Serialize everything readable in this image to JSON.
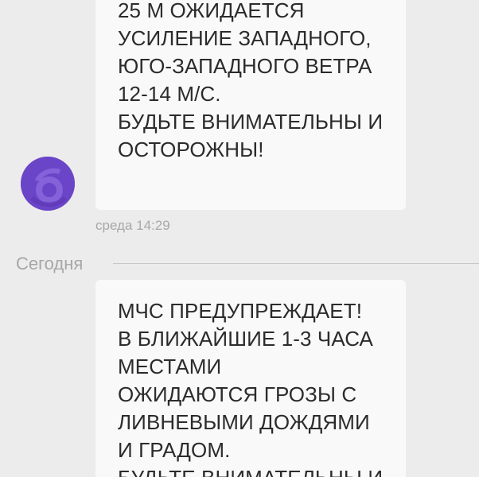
{
  "messages": [
    {
      "lines": [
        "25 М ОЖИДАЕТСЯ",
        "УСИЛЕНИЕ ЗАПАДНОГО,",
        "ЮГО-ЗАПАДНОГО ВЕТРА",
        "12-14 М/С.",
        "БУДЬТЕ ВНИМАТЕЛЬНЫ И",
        "ОСТОРОЖНЫ!"
      ],
      "timestamp": "среда 14:29"
    },
    {
      "lines": [
        "МЧС ПРЕДУПРЕЖДАЕТ!",
        "В БЛИЖАЙШИЕ 1-3 ЧАСА",
        "МЕСТАМИ",
        "ОЖИДАЮТСЯ ГРОЗЫ С",
        "ЛИВНЕВЫМИ ДОЖДЯМИ",
        "И ГРАДОМ.",
        "БУДЬТЕ ВНИМАТЕЛЬНЫ И"
      ]
    }
  ],
  "date_divider": "Сегодня",
  "avatar": {
    "icon": "sender-avatar-icon",
    "color": "#6b45c7"
  },
  "colors": {
    "background": "#ececec",
    "bubble": "#f9f9f9",
    "text": "#2b2b2b",
    "meta": "#a8a8a8"
  }
}
